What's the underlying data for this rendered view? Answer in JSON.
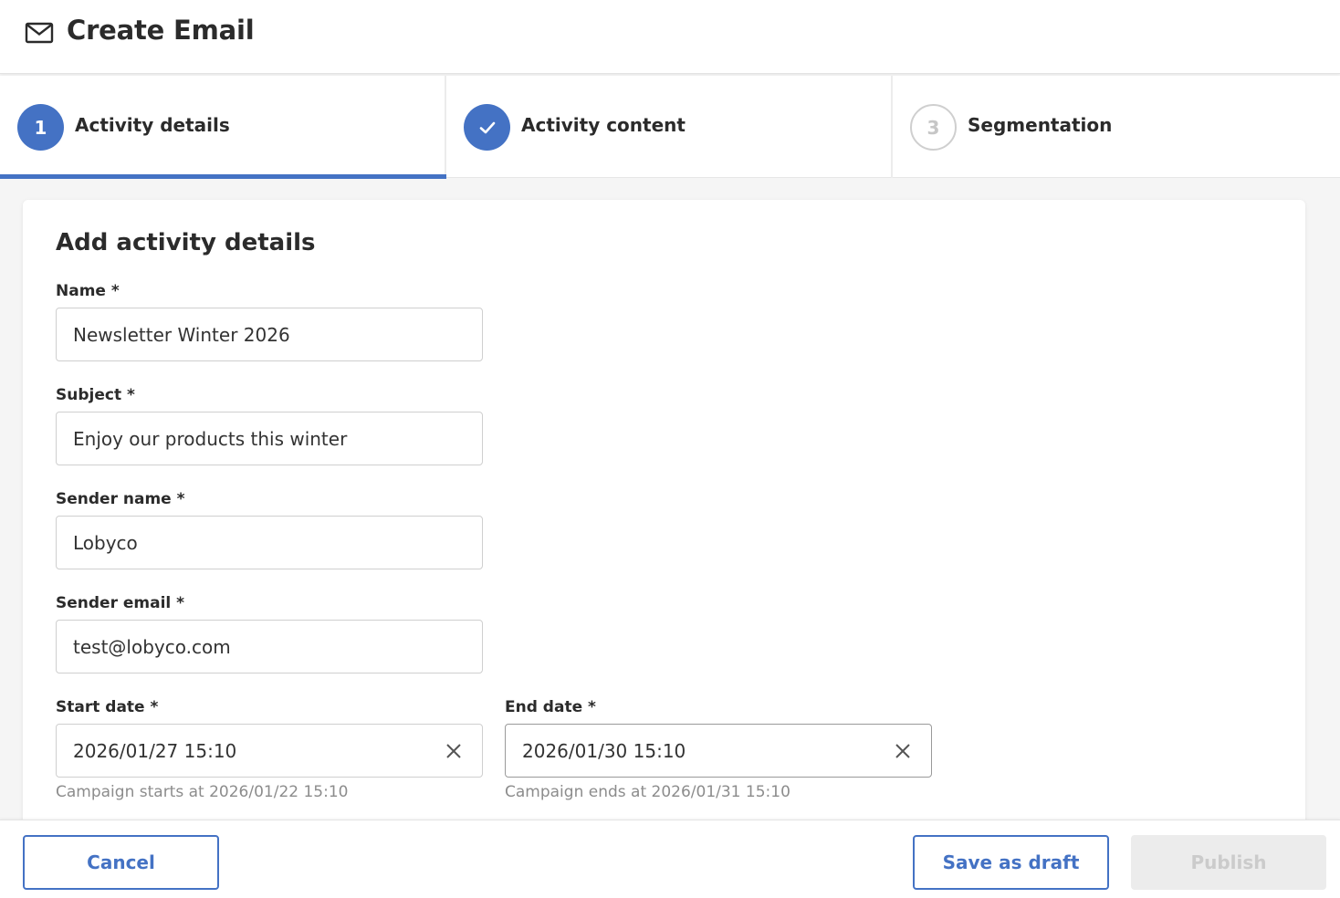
{
  "header": {
    "title": "Create Email",
    "icon": "mail-icon"
  },
  "stepper": {
    "steps": [
      {
        "number": "1",
        "label": "Activity details",
        "state": "active"
      },
      {
        "number": "✓",
        "label": "Activity content",
        "state": "completed"
      },
      {
        "number": "3",
        "label": "Segmentation",
        "state": "pending"
      }
    ]
  },
  "form": {
    "title": "Add activity details",
    "name": {
      "label": "Name *",
      "value": "Newsletter Winter 2026"
    },
    "subject": {
      "label": "Subject *",
      "value": "Enjoy our products this winter"
    },
    "sender_name": {
      "label": "Sender name *",
      "value": "Lobyco"
    },
    "sender_email": {
      "label": "Sender email *",
      "value": "test@lobyco.com"
    },
    "start_date": {
      "label": "Start date *",
      "value": "2026/01/27 15:10",
      "hint": "Campaign starts at 2026/01/22 15:10"
    },
    "end_date": {
      "label": "End date *",
      "value": "2026/01/30 15:10",
      "hint": "Campaign ends at 2026/01/31 15:10"
    }
  },
  "footer": {
    "cancel_label": "Cancel",
    "save_draft_label": "Save as draft",
    "publish_label": "Publish"
  },
  "colors": {
    "accent": "#4472c4",
    "disabled_bg": "#ececec",
    "disabled_text": "#cbcbcb",
    "hint_text": "#8c8c8c"
  }
}
